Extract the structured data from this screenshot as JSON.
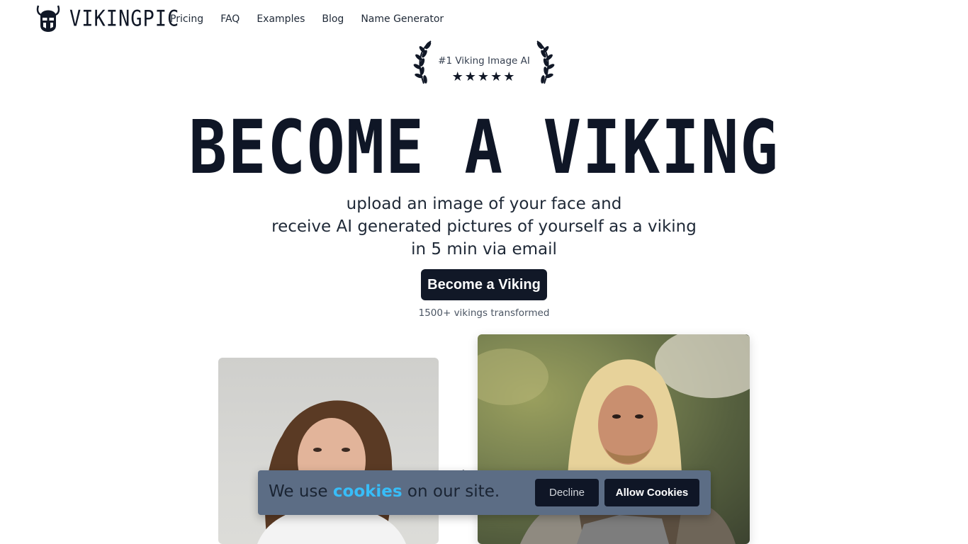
{
  "header": {
    "logo_text": "VIKINGPIC",
    "logo_icon": "viking-helmet-icon",
    "nav": [
      {
        "label": "Pricing"
      },
      {
        "label": "FAQ"
      },
      {
        "label": "Examples"
      },
      {
        "label": "Blog"
      },
      {
        "label": "Name Generator"
      }
    ]
  },
  "badge": {
    "text": "#1 Viking Image AI",
    "stars": "★★★★★",
    "rating": 5,
    "icon": "laurel-wreath-icon"
  },
  "hero": {
    "title": "BECOME A VIKING",
    "subtitle_lines": [
      "upload an image of your face and",
      "receive AI generated pictures of yourself as a viking",
      "in 5 min via email"
    ],
    "cta_label": "Become a Viking",
    "count_text": "1500+ vikings transformed"
  },
  "examples": {
    "arrow": "›"
  },
  "cookie_banner": {
    "text_before": "We use",
    "link_text": "cookies",
    "text_after": "on our site.",
    "decline_label": "Decline",
    "allow_label": "Allow Cookies"
  },
  "colors": {
    "primary": "#111827",
    "cookie_bg": "#5c6d85",
    "link": "#38bdf8"
  }
}
